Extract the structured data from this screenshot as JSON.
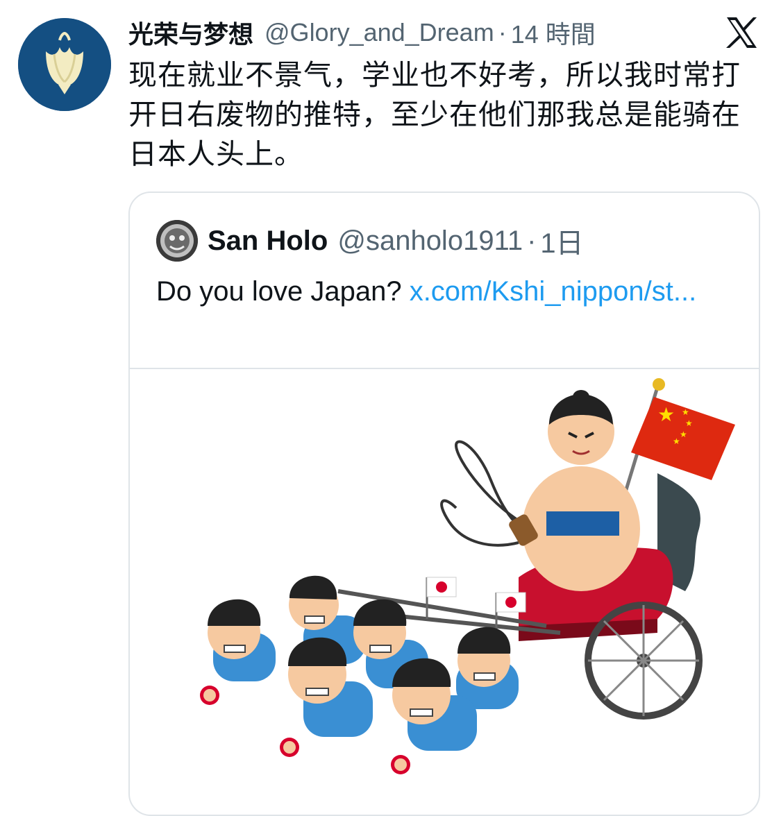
{
  "tweet": {
    "author_name": "光荣与梦想",
    "author_handle": "@Glory_and_Dream",
    "separator": "·",
    "time": "14 時間",
    "text": "现在就业不景气，学业也不好考，所以我时常打开日右废物的推特，至少在他们那我总是能骑在日本人头上。"
  },
  "quoted_tweet": {
    "author_name": "San Holo",
    "author_handle": "@sanholo1911",
    "separator": "·",
    "time": "1日",
    "text": "Do you love Japan? ",
    "link": "x.com/Kshi_nippon/st..."
  },
  "colors": {
    "avatar_bg": "#144f82",
    "link": "#1d9bf0",
    "secondary_text": "#536471",
    "primary_text": "#0f1419",
    "china_flag": "#de2910",
    "japan_red": "#d7002c"
  },
  "icons": {
    "logo": "x-logo-icon",
    "avatar": "tulip-avatar-icon"
  }
}
